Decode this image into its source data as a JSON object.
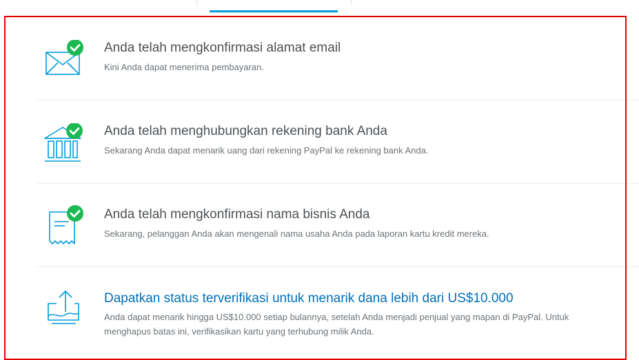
{
  "colors": {
    "accent": "#009cde",
    "check": "#1db954",
    "link": "#0070ba",
    "highlight": "#e00000"
  },
  "items": [
    {
      "icon": "envelope-check-icon",
      "title": "Anda telah mengkonfirmasi alamat email",
      "desc": "Kini Anda dapat menerima pembayaran."
    },
    {
      "icon": "bank-check-icon",
      "title": "Anda telah menghubungkan rekening bank Anda",
      "desc": "Sekarang Anda dapat menarik uang dari rekening PayPal ke rekening bank Anda."
    },
    {
      "icon": "receipt-check-icon",
      "title": "Anda telah mengkonfirmasi nama bisnis Anda",
      "desc": "Sekarang, pelanggan Anda akan mengenali nama usaha Anda pada laporan kartu kredit mereka."
    },
    {
      "icon": "upload-icon",
      "title": "Dapatkan status terverifikasi untuk menarik dana lebih dari US$10.000",
      "desc": "Anda dapat menarik hingga US$10.000 setiap bulannya, setelah Anda menjadi penjual yang mapan di PayPal. Untuk menghapus batas ini, verifikasikan kartu yang terhubung milik Anda."
    }
  ]
}
